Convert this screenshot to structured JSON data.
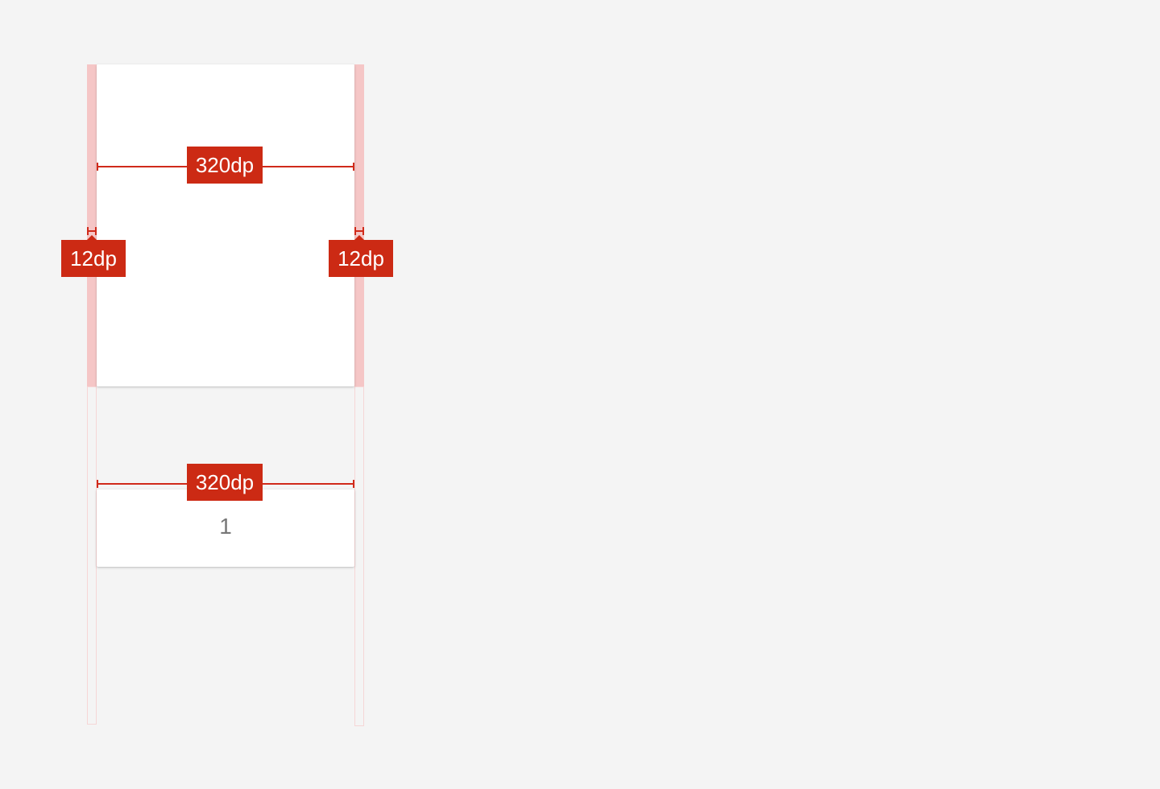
{
  "diagram": {
    "top_card": {
      "width_label": "320dp",
      "left_margin_label": "12dp",
      "right_margin_label": "12dp"
    },
    "bottom_card": {
      "width_label": "320dp",
      "content": "1"
    },
    "colors": {
      "background": "#f4f4f4",
      "card": "#ffffff",
      "accent_red": "#cc2a14",
      "guide_strong": "#f5c6c6",
      "guide_faint": "#f6d6d6",
      "number_text": "#777777"
    }
  }
}
